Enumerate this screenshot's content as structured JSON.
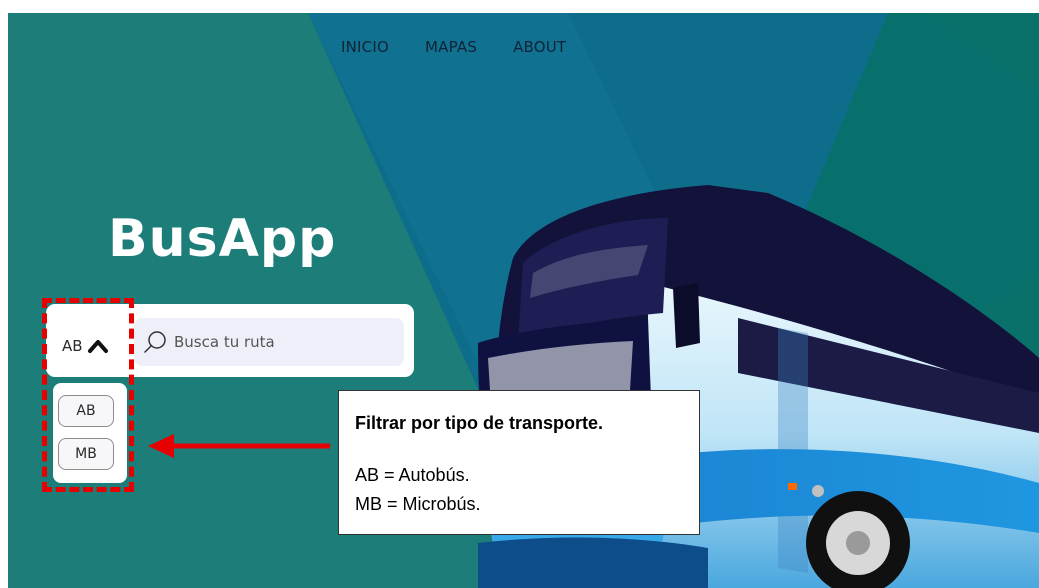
{
  "colors": {
    "background": "#1b7d7b",
    "panel": "#ffffff",
    "search_field": "#edf0f8",
    "highlight": "#e60000"
  },
  "nav": {
    "items": [
      "INICIO",
      "MAPAS",
      "ABOUT"
    ]
  },
  "hero": {
    "title": "BusApp",
    "illustration": "bus-illustration"
  },
  "filter": {
    "selected": "AB",
    "toggle_icon": "chevron-up-icon",
    "options": [
      "AB",
      "MB"
    ]
  },
  "search": {
    "icon": "search-icon",
    "placeholder": "Busca tu ruta"
  },
  "callout": {
    "title": "Filtrar por tipo de transporte.",
    "lines": [
      "AB = Autobús.",
      "MB = Microbús."
    ]
  }
}
